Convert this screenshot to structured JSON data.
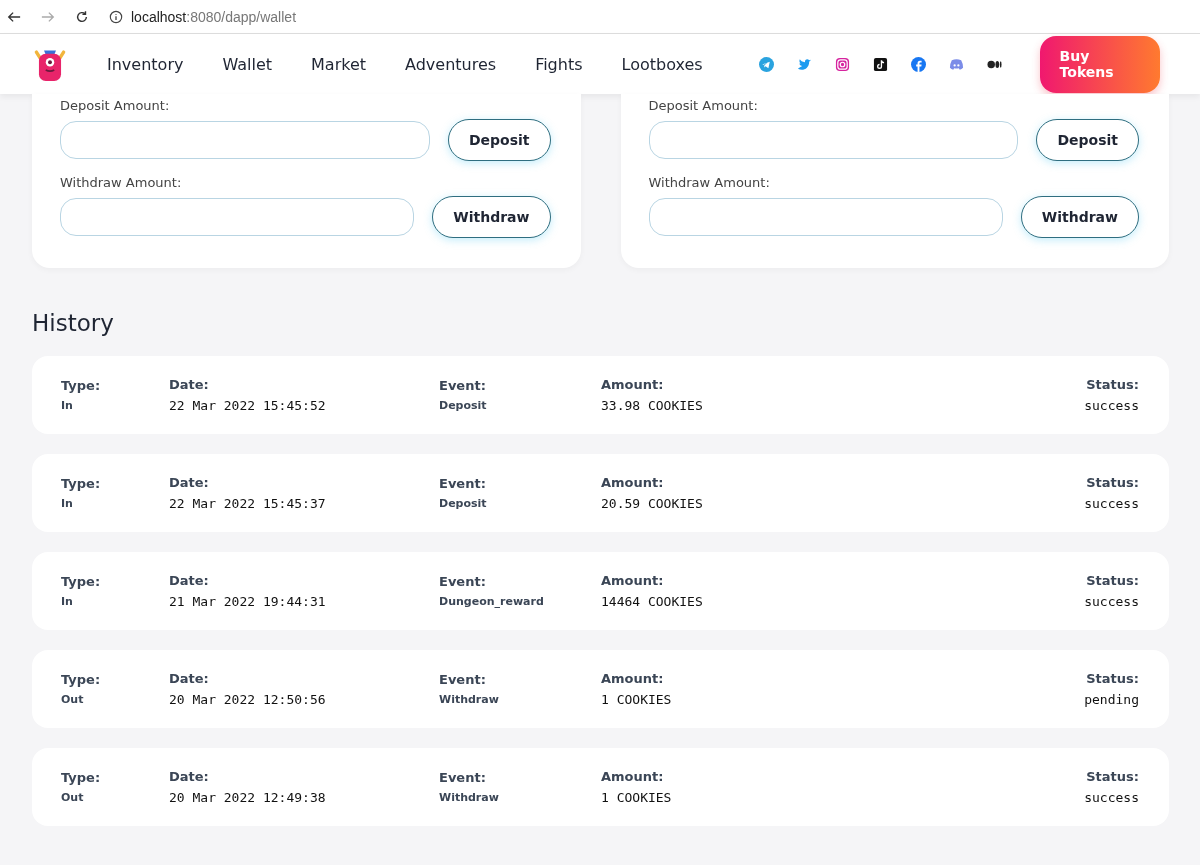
{
  "browser": {
    "url_host": "localhost",
    "url_path": ":8080/dapp/wallet"
  },
  "nav": {
    "items": [
      "Inventory",
      "Wallet",
      "Market",
      "Adventures",
      "Fights",
      "Lootboxes"
    ],
    "socials": [
      {
        "kind": "telegram"
      },
      {
        "kind": "twitter"
      },
      {
        "kind": "instagram"
      },
      {
        "kind": "tiktok"
      },
      {
        "kind": "facebook"
      },
      {
        "kind": "discord"
      },
      {
        "kind": "medium"
      }
    ],
    "buy_button": "Buy Tokens"
  },
  "wallets": [
    {
      "deposit_label": "Deposit Amount:",
      "deposit_button": "Deposit",
      "withdraw_label": "Withdraw Amount:",
      "withdraw_button": "Withdraw"
    },
    {
      "deposit_label": "Deposit Amount:",
      "deposit_button": "Deposit",
      "withdraw_label": "Withdraw Amount:",
      "withdraw_button": "Withdraw"
    }
  ],
  "history": {
    "title": "History",
    "rows": [
      {
        "type_label": "Type:",
        "type": "In",
        "date_label": "Date:",
        "date": "22 Mar 2022 15:45:52",
        "event_label": "Event:",
        "event": "Deposit",
        "amount_label": "Amount:",
        "amount": "33.98 COOKIES",
        "status_label": "Status:",
        "status": "success"
      },
      {
        "type_label": "Type:",
        "type": "In",
        "date_label": "Date:",
        "date": "22 Mar 2022 15:45:37",
        "event_label": "Event:",
        "event": "Deposit",
        "amount_label": "Amount:",
        "amount": "20.59 COOKIES",
        "status_label": "Status:",
        "status": "success"
      },
      {
        "type_label": "Type:",
        "type": "In",
        "date_label": "Date:",
        "date": "21 Mar 2022 19:44:31",
        "event_label": "Event:",
        "event": "Dungeon_reward",
        "amount_label": "Amount:",
        "amount": "14464 COOKIES",
        "status_label": "Status:",
        "status": "success"
      },
      {
        "type_label": "Type:",
        "type": "Out",
        "date_label": "Date:",
        "date": "20 Mar 2022 12:50:56",
        "event_label": "Event:",
        "event": "Withdraw",
        "amount_label": "Amount:",
        "amount": "1 COOKIES",
        "status_label": "Status:",
        "status": "pending"
      },
      {
        "type_label": "Type:",
        "type": "Out",
        "date_label": "Date:",
        "date": "20 Mar 2022 12:49:38",
        "event_label": "Event:",
        "event": "Withdraw",
        "amount_label": "Amount:",
        "amount": "1 COOKIES",
        "status_label": "Status:",
        "status": "success"
      }
    ]
  }
}
